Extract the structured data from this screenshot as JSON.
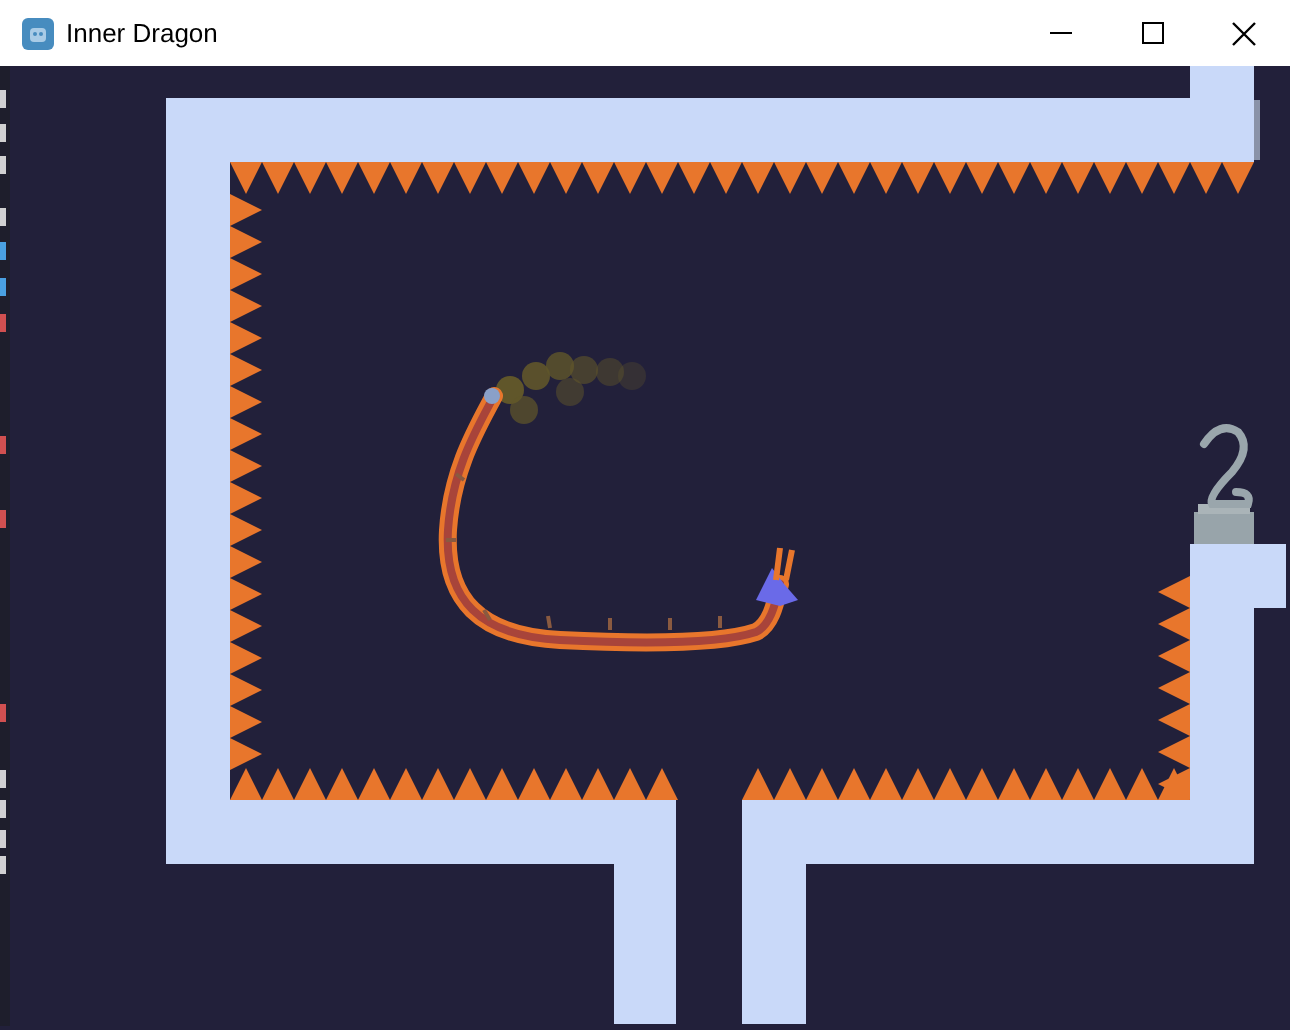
{
  "window": {
    "title": "Inner Dragon"
  }
}
